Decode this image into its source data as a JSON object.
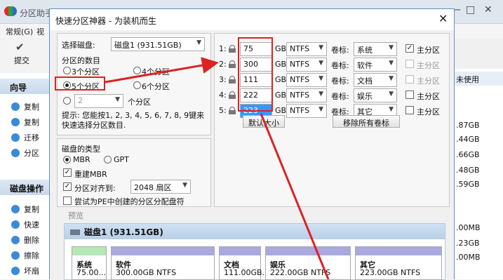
{
  "bg": {
    "title": "分区助手",
    "win_minimize": "—",
    "win_maximize": "□",
    "win_close": "✕",
    "menu": [
      "常规(G)",
      "视"
    ],
    "commit_label": "提交",
    "side_head_wizard": "向导",
    "side_head_disk": "磁盘操作",
    "wizard_items": [
      "复制",
      "复制",
      "迁移",
      "分区"
    ],
    "disk_items": [
      "复制",
      "快速",
      "删除",
      "擦除",
      "坏扇"
    ],
    "right_header": "未使用",
    "right_values": [
      ".87GB",
      ".44GB",
      ".66GB",
      ".48GB",
      ".59GB",
      ".00MB",
      ".23GB",
      ".00MB"
    ]
  },
  "dialog": {
    "title": "快速分区神器 - 为装机而生",
    "close": "✕",
    "disk_select_label": "选择磁盘:",
    "disk_select_value": "磁盘1 (931.51GB)",
    "count_label": "分区的数目",
    "count_options": [
      "3个分区",
      "4个分区",
      "5个分区",
      "6个分区"
    ],
    "custom_count": "2",
    "custom_count_suffix": "个分区",
    "hint": "提示: 您能按1, 2, 3, 4, 5, 6, 7, 8, 9键来快速选择分区数目.",
    "disk_type_label": "磁盘的类型",
    "mbr": "MBR",
    "gpt": "GPT",
    "rebuild_mbr": "重建MBR",
    "align_label": "分区对齐到:",
    "align_value": "2048 扇区",
    "pe_label": "尝试为PE中创建的分区分配盘符",
    "default_size_button": "默认大小",
    "remove_labels_button": "移除所有卷标",
    "unit": "GB",
    "fs_label_prefix": "卷标:",
    "primary_label": "主分区",
    "partitions": [
      {
        "index": "1:",
        "size": "75",
        "fs": "NTFS",
        "label": "系统",
        "primary": true
      },
      {
        "index": "2:",
        "size": "300",
        "fs": "NTFS",
        "label": "软件",
        "primary": false
      },
      {
        "index": "3:",
        "size": "111",
        "fs": "NTFS",
        "label": "文档",
        "primary": false
      },
      {
        "index": "4:",
        "size": "222",
        "fs": "NTFS",
        "label": "娱乐",
        "primary": false
      },
      {
        "index": "5:",
        "size": "223",
        "fs": "NTFS",
        "label": "其它",
        "primary": false
      }
    ],
    "preview_label": "预览",
    "preview_disk": "磁盘1 (931.51GB)",
    "preview_parts": [
      {
        "name": "系统",
        "size": "75.00..."
      },
      {
        "name": "软件",
        "size": "300.00GB NTFS"
      },
      {
        "name": "文档",
        "size": "111.00GB..."
      },
      {
        "name": "娱乐",
        "size": "222.00GB NTFS"
      },
      {
        "name": "其它",
        "size": "223.00GB NTFS"
      }
    ]
  },
  "colors": {
    "accent": "#3399ff",
    "annotation": "#dd2222",
    "part_bar": "#a9a9e0",
    "system_bar": "#b6e7b6"
  }
}
